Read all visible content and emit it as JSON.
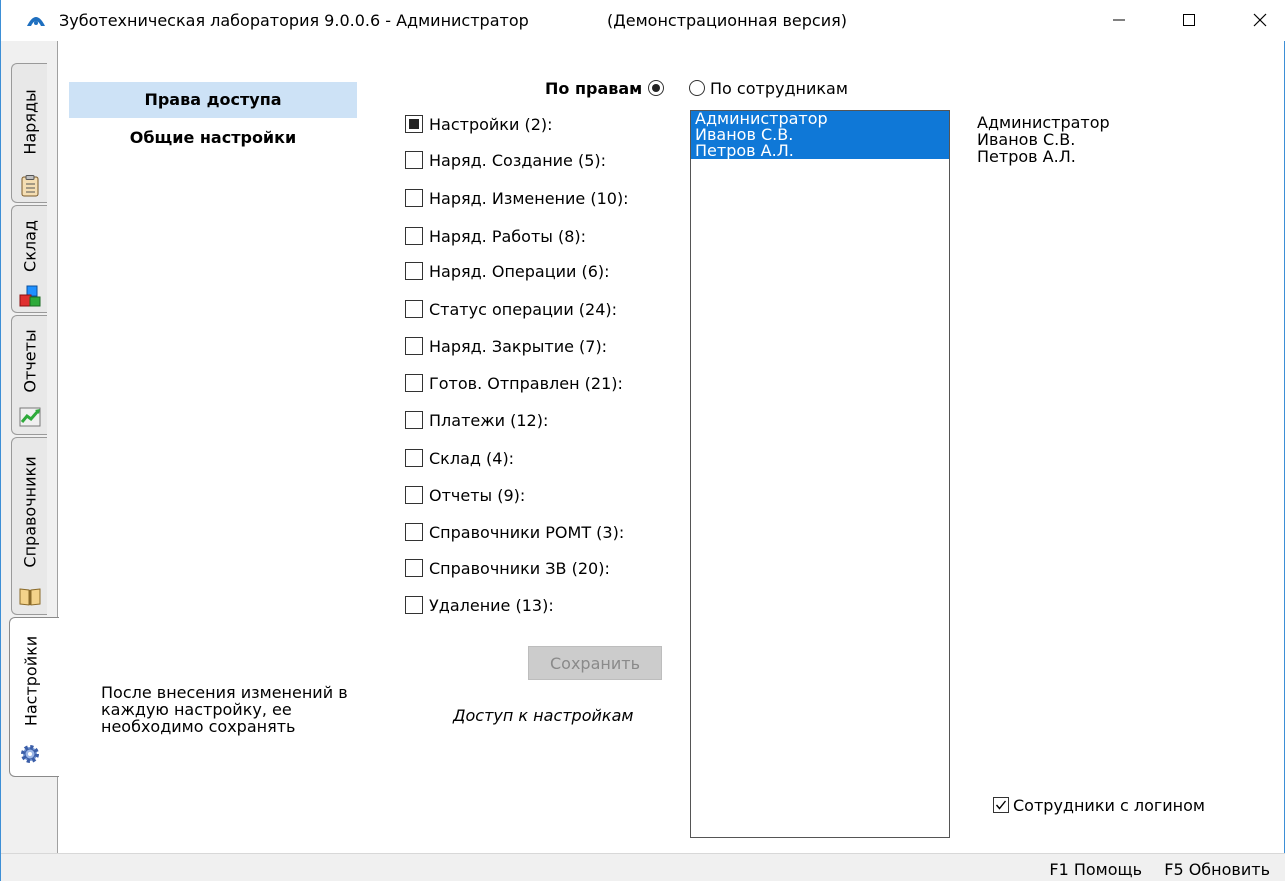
{
  "window": {
    "title": "Зуботехническая лаборатория 9.0.0.6 - Администратор",
    "title_note": "(Демонстрационная версия)",
    "minimize": "—",
    "maximize": "☐",
    "close": "✕"
  },
  "tabs": [
    {
      "label": "Наряды",
      "icon": "clipboard-icon",
      "active": false
    },
    {
      "label": "Склад",
      "icon": "blocks-icon",
      "active": false
    },
    {
      "label": "Отчеты",
      "icon": "chart-trend-icon",
      "active": false
    },
    {
      "label": "Справочники",
      "icon": "book-icon",
      "active": false
    },
    {
      "label": "Настройки",
      "icon": "gear-icon",
      "active": true
    }
  ],
  "left_panel": {
    "items": [
      {
        "label": "Права доступа",
        "selected": true
      },
      {
        "label": "Общие настройки",
        "selected": false
      }
    ],
    "note": "После внесения изменений в каждую настройку, ее необходимо сохранять"
  },
  "mode": {
    "by_rights_label": "По правам",
    "by_employees_label": "По сотрудникам",
    "selected": "by_rights"
  },
  "rights": [
    {
      "label": "Настройки (2):",
      "state": "partial"
    },
    {
      "label": "Наряд. Создание (5):",
      "state": "unchecked"
    },
    {
      "label": "Наряд. Изменение (10):",
      "state": "unchecked"
    },
    {
      "label": "Наряд. Работы (8):",
      "state": "unchecked"
    },
    {
      "label": "Наряд. Операции (6):",
      "state": "unchecked"
    },
    {
      "label": "Статус операции (24):",
      "state": "unchecked"
    },
    {
      "label": "Наряд. Закрытие (7):",
      "state": "unchecked"
    },
    {
      "label": "Готов. Отправлен (21):",
      "state": "unchecked"
    },
    {
      "label": "Платежи (12):",
      "state": "unchecked"
    },
    {
      "label": "Склад (4):",
      "state": "unchecked"
    },
    {
      "label": "Отчеты (9):",
      "state": "unchecked"
    },
    {
      "label": "Справочники РОМТ (3):",
      "state": "unchecked"
    },
    {
      "label": "Справочники ЗВ (20):",
      "state": "unchecked"
    },
    {
      "label": "Удаление (13):",
      "state": "unchecked"
    }
  ],
  "save_button": "Сохранить",
  "access_caption": "Доступ к настройкам",
  "employees": [
    "Администратор",
    "Иванов С.В.",
    "Петров А.Л."
  ],
  "employees_right": [
    "Администратор",
    "Иванов С.В.",
    "Петров А.Л."
  ],
  "logins_checkbox": {
    "label": "Сотрудники с логином",
    "checked": true
  },
  "status": {
    "help": "F1 Помощь",
    "refresh": "F5 Обновить"
  },
  "colors": {
    "accent": "#0f78d7",
    "selected_nav": "#cde2f6",
    "window_border": "#3d8fd6"
  }
}
